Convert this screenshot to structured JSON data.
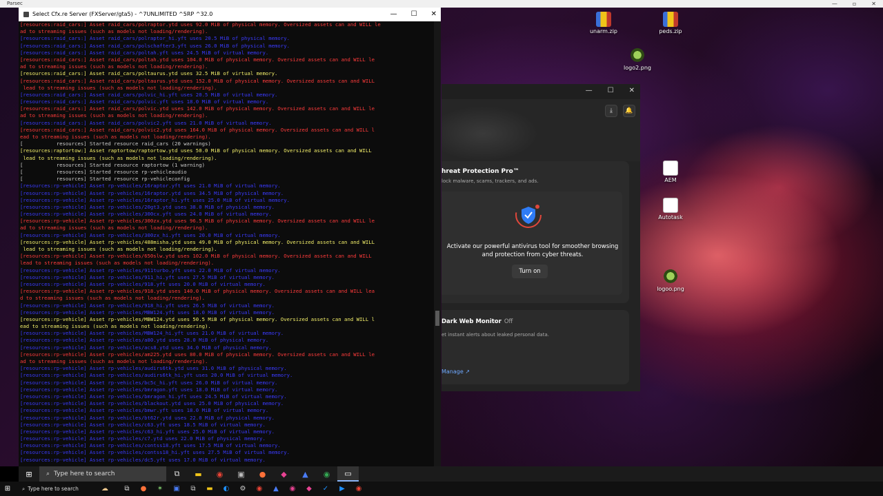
{
  "parsec": {
    "title": "Parsec"
  },
  "desktop": {
    "icons": [
      {
        "label": "unarm.zip"
      },
      {
        "label": "peds.zip"
      },
      {
        "label": "logo2.png"
      },
      {
        "label": "AEM"
      },
      {
        "label": "Autotask"
      },
      {
        "label": "logoo.png"
      }
    ]
  },
  "console": {
    "title": "Select Cfx.re Server (FXServer/gta5) - ^7UNLIMITED ^5RP ^32.0",
    "lines": [
      {
        "c": "r",
        "t": "[resources:raid_cars:] Asset raid_cars/polraptor.ytd uses 92.0 MiB of physical memory. Oversized assets can and WILL le"
      },
      {
        "c": "r",
        "t": "ad to streaming issues (such as models not loading/rendering)."
      },
      {
        "c": "b",
        "t": "[resources:raid_cars:] Asset raid_cars/polraptor_hi.yft uses 20.5 MiB of physical memory."
      },
      {
        "c": "b",
        "t": "[resources:raid_cars:] Asset raid_cars/polschafter3.yft uses 26.0 MiB of physical memory."
      },
      {
        "c": "b",
        "t": "[resources:raid_cars:] Asset raid_cars/poltah.yft uses 24.5 MiB of virtual memory."
      },
      {
        "c": "r",
        "t": "[resources:raid_cars:] Asset raid_cars/poltah.ytd uses 104.0 MiB of physical memory. Oversized assets can and WILL le"
      },
      {
        "c": "r",
        "t": "ad to streaming issues (such as models not loading/rendering)."
      },
      {
        "c": "y",
        "t": "[resources:raid_cars:] Asset raid_cars/poltaurus.ytd uses 32.5 MiB of virtual memory."
      },
      {
        "c": "r",
        "t": "[resources:raid_cars:] Asset raid_cars/poltaurus.ytd uses 152.0 MiB of physical memory. Oversized assets can and WILL"
      },
      {
        "c": "r",
        "t": " lead to streaming issues (such as models not loading/rendering)."
      },
      {
        "c": "b",
        "t": "[resources:raid_cars:] Asset raid_cars/polvic_hi.yft uses 20.5 MiB of virtual memory."
      },
      {
        "c": "b",
        "t": "[resources:raid_cars:] Asset raid_cars/polvic.yft uses 18.0 MiB of virtual memory."
      },
      {
        "c": "r",
        "t": "[resources:raid_cars:] Asset raid_cars/polvic.ytd uses 142.0 MiB of physical memory. Oversized assets can and WILL le"
      },
      {
        "c": "r",
        "t": "ad to streaming issues (such as models not loading/rendering)."
      },
      {
        "c": "b",
        "t": "[resources:raid_cars:] Asset raid_cars/polvic2.yft uses 21.0 MiB of virtual memory."
      },
      {
        "c": "r",
        "t": "[resources:raid_cars:] Asset raid_cars/polvic2.ytd uses 164.0 MiB of physical memory. Oversized assets can and WILL l"
      },
      {
        "c": "r",
        "t": "ead to streaming issues (such as models not loading/rendering)."
      },
      {
        "c": "w",
        "t": "[           resources] Started resource raid_cars (20 warnings)"
      },
      {
        "c": "y",
        "t": "[resources:raptortow:] Asset raptortow/raptortow.ytd uses 50.0 MiB of physical memory. Oversized assets can and WILL"
      },
      {
        "c": "y",
        "t": " lead to streaming issues (such as models not loading/rendering)."
      },
      {
        "c": "w",
        "t": "[           resources] Started resource raptortow (1 warning)"
      },
      {
        "c": "w",
        "t": "[           resources] Started resource rp-vehicleaudio"
      },
      {
        "c": "w",
        "t": "[           resources] Started resource rp-vehicleconfig"
      },
      {
        "c": "b",
        "t": "[resources:rp-vehicle] Asset rp-vehicles/16raptor.yft uses 21.0 MiB of virtual memory."
      },
      {
        "c": "b",
        "t": "[resources:rp-vehicle] Asset rp-vehicles/16raptor.ytd uses 34.5 MiB of physical memory."
      },
      {
        "c": "b",
        "t": "[resources:rp-vehicle] Asset rp-vehicles/16raptor_hi.yft uses 25.0 MiB of virtual memory."
      },
      {
        "c": "b",
        "t": "[resources:rp-vehicle] Asset rp-vehicles/20gt3.ytd uses 38.0 MiB of physical memory."
      },
      {
        "c": "b",
        "t": "[resources:rp-vehicle] Asset rp-vehicles/300cx.yft uses 24.0 MiB of virtual memory."
      },
      {
        "c": "r",
        "t": "[resources:rp-vehicle] Asset rp-vehicles/300zx.ytd uses 96.5 MiB of physical memory. Oversized assets can and WILL le"
      },
      {
        "c": "r",
        "t": "ad to streaming issues (such as models not loading/rendering)."
      },
      {
        "c": "b",
        "t": "[resources:rp-vehicle] Asset rp-vehicles/300zx_hi.yft uses 20.0 MiB of virtual memory."
      },
      {
        "c": "y",
        "t": "[resources:rp-vehicle] Asset rp-vehicles/488misha.ytd uses 49.0 MiB of physical memory. Oversized assets can and WILL"
      },
      {
        "c": "y",
        "t": " lead to streaming issues (such as models not loading/rendering)."
      },
      {
        "c": "r",
        "t": "[resources:rp-vehicle] Asset rp-vehicles/650slw.ytd uses 102.0 MiB of physical memory. Oversized assets can and WILL"
      },
      {
        "c": "r",
        "t": "lead to streaming issues (such as models not loading/rendering)."
      },
      {
        "c": "b",
        "t": "[resources:rp-vehicle] Asset rp-vehicles/911turbo.yft uses 22.0 MiB of virtual memory."
      },
      {
        "c": "b",
        "t": "[resources:rp-vehicle] Asset rp-vehicles/911_hi.yft uses 27.5 MiB of virtual memory."
      },
      {
        "c": "b",
        "t": "[resources:rp-vehicle] Asset rp-vehicles/918.yft uses 20.0 MiB of virtual memory."
      },
      {
        "c": "r",
        "t": "[resources:rp-vehicle] Asset rp-vehicles/918.ytd uses 140.0 MiB of physical memory. Oversized assets can and WILL lea"
      },
      {
        "c": "r",
        "t": "d to streaming issues (such as models not loading/rendering)."
      },
      {
        "c": "b",
        "t": "[resources:rp-vehicle] Asset rp-vehicles/918_hi.yft uses 26.5 MiB of virtual memory."
      },
      {
        "c": "b",
        "t": "[resources:rp-vehicle] Asset rp-vehicles/MBW124.yft uses 18.0 MiB of virtual memory."
      },
      {
        "c": "y",
        "t": "[resources:rp-vehicle] Asset rp-vehicles/MBW124.ytd uses 50.5 MiB of physical memory. Oversized assets can and WILL l"
      },
      {
        "c": "y",
        "t": "ead to streaming issues (such as models not loading/rendering)."
      },
      {
        "c": "b",
        "t": "[resources:rp-vehicle] Asset rp-vehicles/MBW124_hi.yft uses 21.0 MiB of virtual memory."
      },
      {
        "c": "b",
        "t": "[resources:rp-vehicle] Asset rp-vehicles/a80.ytd uses 28.0 MiB of physical memory."
      },
      {
        "c": "b",
        "t": "[resources:rp-vehicle] Asset rp-vehicles/acs8.ytd uses 34.0 MiB of physical memory."
      },
      {
        "c": "r",
        "t": "[resources:rp-vehicle] Asset rp-vehicles/am225.ytd uses 80.0 MiB of physical memory. Oversized assets can and WILL le"
      },
      {
        "c": "r",
        "t": "ad to streaming issues (such as models not loading/rendering)."
      },
      {
        "c": "b",
        "t": "[resources:rp-vehicle] Asset rp-vehicles/audirs6tk.ytd uses 31.0 MiB of physical memory."
      },
      {
        "c": "b",
        "t": "[resources:rp-vehicle] Asset rp-vehicles/audirs6tk_hi.yft uses 20.0 MiB of virtual memory."
      },
      {
        "c": "b",
        "t": "[resources:rp-vehicle] Asset rp-vehicles/bc5c_hi.yft uses 26.0 MiB of virtual memory."
      },
      {
        "c": "b",
        "t": "[resources:rp-vehicle] Asset rp-vehicles/bmragon.yft uses 18.0 MiB of virtual memory."
      },
      {
        "c": "b",
        "t": "[resources:rp-vehicle] Asset rp-vehicles/bmragon_hi.yft uses 24.5 MiB of virtual memory."
      },
      {
        "c": "b",
        "t": "[resources:rp-vehicle] Asset rp-vehicles/blackout.ytd uses 25.0 MiB of physical memory."
      },
      {
        "c": "b",
        "t": "[resources:rp-vehicle] Asset rp-vehicles/bmwr.yft uses 18.0 MiB of virtual memory."
      },
      {
        "c": "b",
        "t": "[resources:rp-vehicle] Asset rp-vehicles/bt62r.ytd uses 22.0 MiB of physical memory."
      },
      {
        "c": "b",
        "t": "[resources:rp-vehicle] Asset rp-vehicles/c63.yft uses 18.5 MiB of virtual memory."
      },
      {
        "c": "b",
        "t": "[resources:rp-vehicle] Asset rp-vehicles/c63_hi.yft uses 25.0 MiB of virtual memory."
      },
      {
        "c": "b",
        "t": "[resources:rp-vehicle] Asset rp-vehicles/c7.ytd uses 22.0 MiB of physical memory."
      },
      {
        "c": "b",
        "t": "[resources:rp-vehicle] Asset rp-vehicles/contss18.yft uses 17.5 MiB of virtual memory."
      },
      {
        "c": "b",
        "t": "[resources:rp-vehicle] Asset rp-vehicles/contss18_hi.yft uses 27.5 MiB of virtual memory."
      },
      {
        "c": "b",
        "t": "[resources:rp-vehicle] Asset rp-vehicles/dc5.yft uses 17.0 MiB of virtual memory."
      }
    ]
  },
  "antivirus": {
    "threat_title": "hreat Protection Pro™",
    "threat_sub": "lock malware, scams, trackers, and ads.",
    "message": "Activate our powerful antivirus tool for smoother browsing and protection from cyber threats.",
    "turn_on": "Turn on",
    "dwm_title": "Dark Web Monitor",
    "dwm_state": "Off",
    "dwm_sub": "et instant alerts about leaked personal data.",
    "manage": "Manage ↗"
  },
  "taskbar": {
    "search_placeholder": "Type here to search",
    "icons": [
      "task-view",
      "file-explorer",
      "chrome",
      "app",
      "firefox",
      "app2",
      "app3",
      "chrome2",
      "terminal"
    ]
  },
  "host_taskbar": {
    "search_placeholder": "Type here to search"
  }
}
